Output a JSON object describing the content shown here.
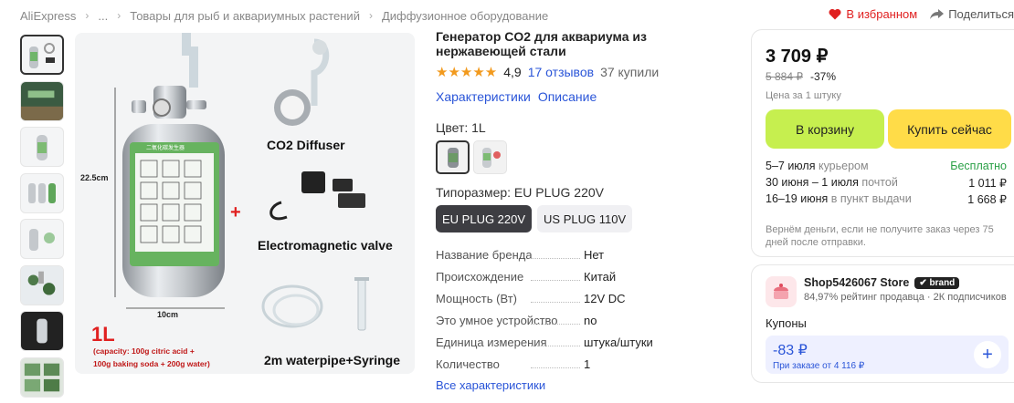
{
  "breadcrumb": {
    "items": [
      "AliExpress",
      "...",
      "Товары для рыб и аквариумных растений",
      "Диффузионное оборудование"
    ]
  },
  "actions": {
    "favorite": "В избранном",
    "share": "Поделиться"
  },
  "image": {
    "height_label": "22.5cm",
    "width_label": "10cm",
    "size_big": "1L",
    "capacity_lines": [
      "(capacity: 100g citric acid +",
      "100g baking soda + 200g water)"
    ],
    "plus": "+",
    "diffuser_label": "CO2 Diffuser",
    "valve_label": "Electromagnetic valve",
    "pipe_label": "2m waterpipe+Syringe"
  },
  "product": {
    "title": "Генератор CO2 для аквариума из нержавеющей стали",
    "stars": "★★★★★",
    "rating": "4,9",
    "reviews": "17 отзывов",
    "purchases": "37 купили",
    "tabs": [
      "Характеристики",
      "Описание"
    ],
    "color_label": "Цвет: 1L",
    "size_label": "Типоразмер: EU PLUG 220V",
    "sizes": [
      "EU PLUG 220V",
      "US PLUG 110V"
    ],
    "props": [
      {
        "k": "Название бренда",
        "v": "Нет"
      },
      {
        "k": "Происхождение",
        "v": "Китай"
      },
      {
        "k": "Мощность (Вт)",
        "v": "12V DC"
      },
      {
        "k": "Это умное устройство",
        "v": "no"
      },
      {
        "k": "Единица измерения",
        "v": "штука/штуки"
      },
      {
        "k": "Количество",
        "v": "1"
      }
    ],
    "all_props": "Все характеристики"
  },
  "buy": {
    "price": "3 709 ₽",
    "old_price": "5 884 ₽",
    "discount": "-37%",
    "unit_note": "Цена за 1 штуку",
    "cart": "В корзину",
    "buy_now": "Купить сейчас",
    "delivery": [
      {
        "date": "5–7 июля",
        "method": " курьером",
        "price": "Бесплатно"
      },
      {
        "date": "30 июня – 1 июля",
        "method": " почтой",
        "price": "1 011 ₽"
      },
      {
        "date": "16–19 июня",
        "method": " в пункт выдачи",
        "price": "1 668 ₽"
      }
    ],
    "refund": "Вернём деньги, если не получите заказ через 75 дней после отправки."
  },
  "store": {
    "name": "Shop5426067 Store",
    "badge": "brand",
    "rating": "84,97% рейтинг продавца",
    "subscribers": "2К подписчиков",
    "coupons_label": "Купоны",
    "coupon_amount": "-83 ₽",
    "coupon_condition": "При заказе от 4 116 ₽",
    "plus": "+"
  },
  "colors": {
    "accent_link": "#2a55d8",
    "cart": "#c6ef4f",
    "buy": "#ffdc48",
    "star": "#f29a1e",
    "favorite": "#e02020"
  }
}
